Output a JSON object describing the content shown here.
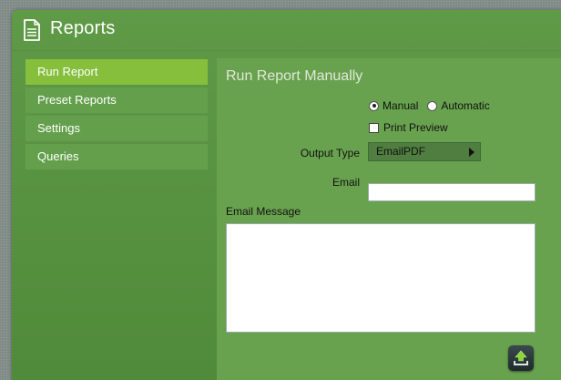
{
  "header": {
    "title": "Reports",
    "icon": "document-icon"
  },
  "sidebar": {
    "items": [
      {
        "label": "Run Report",
        "active": true
      },
      {
        "label": "Preset Reports",
        "active": false
      },
      {
        "label": "Settings",
        "active": false
      },
      {
        "label": "Queries",
        "active": false
      }
    ]
  },
  "panel": {
    "title": "Run Report Manually",
    "mode": {
      "options": [
        "Manual",
        "Automatic"
      ],
      "selected": "Manual"
    },
    "print_preview": {
      "label": "Print Preview",
      "checked": false
    },
    "output_type": {
      "label": "Output Type",
      "value": "EmailPDF"
    },
    "email": {
      "label": "Email",
      "value": ""
    },
    "email_message": {
      "label": "Email Message",
      "value": ""
    },
    "submit_icon": "upload-icon"
  },
  "colors": {
    "accent": "#85bf3c",
    "window_bg": "#5b9444",
    "panel_bg": "#69a24f"
  }
}
